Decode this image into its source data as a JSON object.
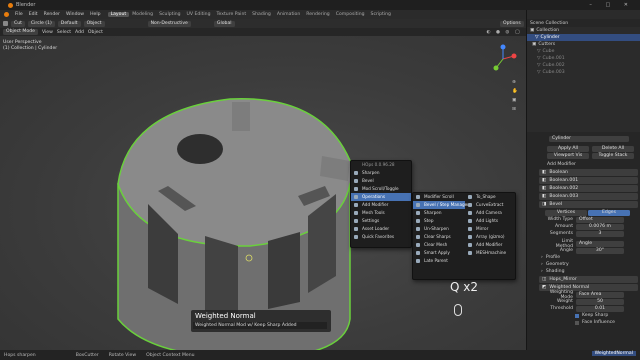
{
  "app": {
    "title": "Blender"
  },
  "menubar": {
    "menus": [
      "File",
      "Edit",
      "Render",
      "Window",
      "Help"
    ],
    "workspaces": [
      "Layout",
      "Modeling",
      "Sculpting",
      "UV Editing",
      "Texture Paint",
      "Shading",
      "Animation",
      "Rendering",
      "Compositing",
      "Scripting"
    ],
    "scene": "Scene",
    "view_layer": "View Layer"
  },
  "toolbar": {
    "tool": "Cut",
    "shape": "Circle (1)",
    "mode": "Default",
    "object": "Object",
    "method": "Non-Destructive",
    "orientation": "Global",
    "options": "Options"
  },
  "viewport_header": {
    "mode": "Object Mode",
    "items": [
      "View",
      "Select",
      "Add",
      "Object"
    ]
  },
  "viewport": {
    "info_line1": "User Perspective",
    "info_line2": "(1) Collection | Cylinder",
    "weighted_title": "Weighted Normal",
    "weighted_sub": "Weighted Normal Mod w/ Keep Sharp Added",
    "key_display": "Q x2"
  },
  "menu_main": {
    "title": "HOps 0.0.96.28",
    "items": [
      "Sharpen",
      "Bevel",
      "Mod Scroll/Toggle",
      "Operations",
      "Add Modifier",
      "Mesh Tools",
      "Settings",
      "Asset Loader",
      "Quick Favorites"
    ]
  },
  "menu_ops": {
    "col1": [
      "Modifier Scroll",
      "Bevel / Step Manager",
      "Sharpen",
      "Step",
      "Un-Sharpen",
      "Clear Sharps",
      "Clear Mesh",
      "Smart Apply",
      "Late Parent"
    ],
    "col2": [
      "To_Shape",
      "CurveExtract",
      "Add Camera",
      "Add Lights",
      "Mirror",
      "Array (gizmo)",
      "Add Modifier",
      "MESHmachine"
    ]
  },
  "outliner": {
    "header": "Scene Collection",
    "items": [
      {
        "name": "Collection",
        "selected": false
      },
      {
        "name": "Cylinder",
        "selected": true
      },
      {
        "name": "Cutters",
        "selected": false
      },
      {
        "name": "Cube",
        "selected": false
      },
      {
        "name": "Cube.001",
        "selected": false
      },
      {
        "name": "Cube.002",
        "selected": false
      },
      {
        "name": "Cube.003",
        "selected": false
      }
    ]
  },
  "properties": {
    "object_name": "Cylinder",
    "apply_all": "Apply All",
    "delete_all": "Delete All",
    "viewport_vis": "Viewport Vis",
    "toggle_stack": "Toggle Stack",
    "add_modifier": "Add Modifier",
    "modifiers": [
      "Boolean",
      "Boolean.001",
      "Boolean.002",
      "Boolean.003",
      "Bevel"
    ],
    "bevel_tabs": [
      "Vertices",
      "Edges"
    ],
    "fields": [
      {
        "label": "Width Type",
        "value": "Offset"
      },
      {
        "label": "Amount",
        "value": "0.0076 m"
      },
      {
        "label": "Segments",
        "value": "3"
      },
      {
        "label": "Limit Method",
        "value": "Angle"
      },
      {
        "label": "Angle",
        "value": "30°"
      }
    ],
    "subpanels": [
      "Profile",
      "Geometry",
      "Shading"
    ],
    "lower_mods": [
      "Hops_Mirror",
      "Weighted Normal"
    ],
    "wn_fields": [
      {
        "label": "Weighting Mode",
        "value": "Face Area"
      },
      {
        "label": "Weight",
        "value": "50"
      },
      {
        "label": "Threshold",
        "value": "0.01"
      }
    ],
    "checks": [
      "Keep Sharp",
      "Face Influence"
    ]
  },
  "status": {
    "left": "Hops sharpen",
    "items": [
      "BoxCutter",
      "Rotate View",
      "Object Context Menu"
    ],
    "right": "WeightedNormal"
  },
  "colors": {
    "accent": "#4772b3",
    "outline": "#6ad03c",
    "selection": "#334d80"
  }
}
